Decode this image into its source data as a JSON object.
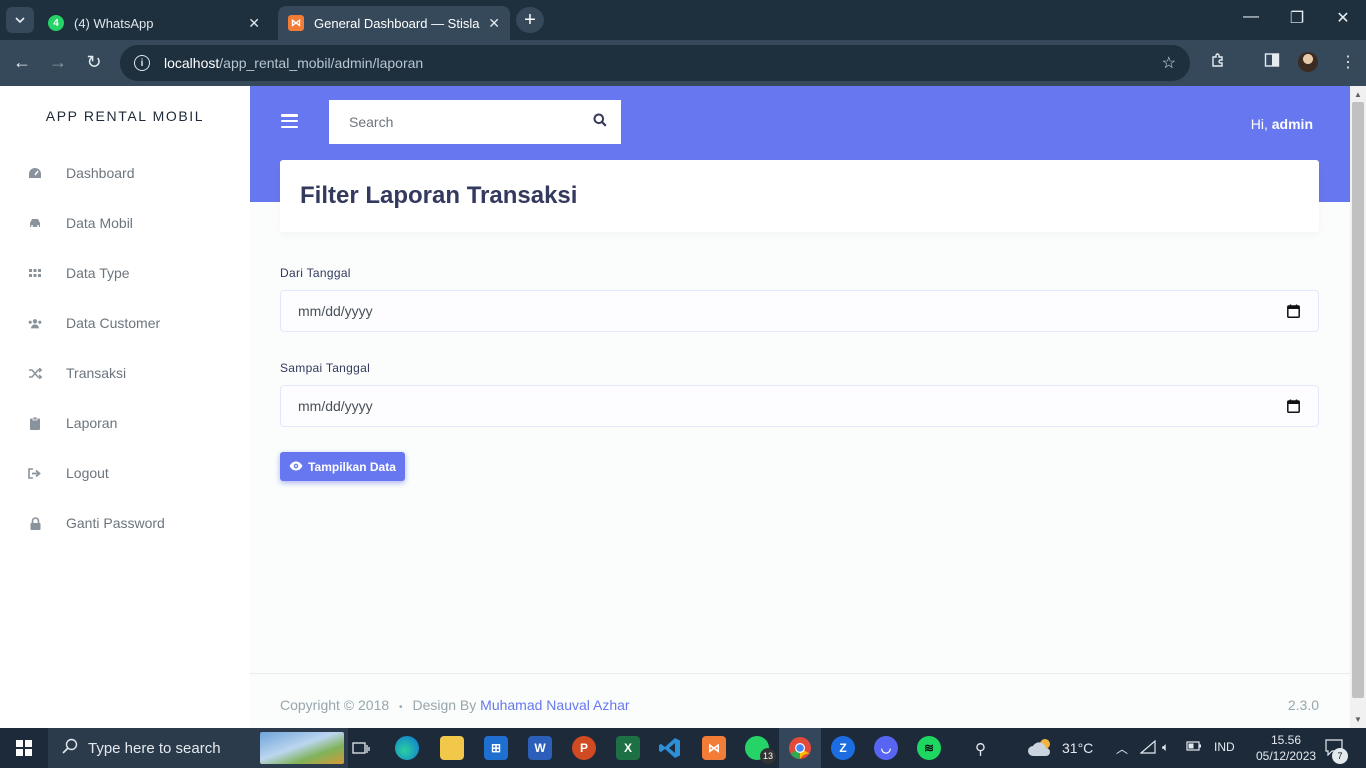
{
  "browser": {
    "tabs": [
      {
        "title": "(4) WhatsApp",
        "badge": "4",
        "active": false
      },
      {
        "title": "General Dashboard — Stisla",
        "active": true
      }
    ],
    "url_host": "localhost",
    "url_path": "/app_rental_mobil/admin/laporan"
  },
  "sidebar": {
    "brand": "APP RENTAL MOBIL",
    "items": [
      {
        "label": "Dashboard",
        "icon": "dashboard-icon"
      },
      {
        "label": "Data Mobil",
        "icon": "car-icon"
      },
      {
        "label": "Data Type",
        "icon": "grid-icon"
      },
      {
        "label": "Data Customer",
        "icon": "users-icon"
      },
      {
        "label": "Transaksi",
        "icon": "random-icon"
      },
      {
        "label": "Laporan",
        "icon": "clipboard-icon"
      },
      {
        "label": "Logout",
        "icon": "sign-out-icon"
      },
      {
        "label": "Ganti Password",
        "icon": "lock-icon"
      }
    ]
  },
  "navbar": {
    "search_placeholder": "Search",
    "greeting": "Hi,",
    "username": "admin"
  },
  "main": {
    "page_title": "Filter Laporan Transaksi",
    "from_label": "Dari Tanggal",
    "from_value": "mm/dd/yyyy",
    "to_label": "Sampai Tanggal",
    "to_value": "mm/dd/yyyy",
    "submit_label": "Tampilkan Data"
  },
  "footer": {
    "copyright": "Copyright © 2018",
    "separator": "•",
    "design_by": "Design By",
    "author": "Muhamad Nauval Azhar",
    "version": "2.3.0"
  },
  "taskbar": {
    "search_placeholder": "Type here to search",
    "whatsapp_badge": "13",
    "temperature": "31°C",
    "language": "IND",
    "time": "15.56",
    "date": "05/12/2023",
    "notification_count": "7"
  },
  "colors": {
    "primary": "#6777ef",
    "chrome_dark": "#1e2f3d",
    "chrome_toolbar": "#35495a",
    "taskbar": "#1c2a3a"
  }
}
